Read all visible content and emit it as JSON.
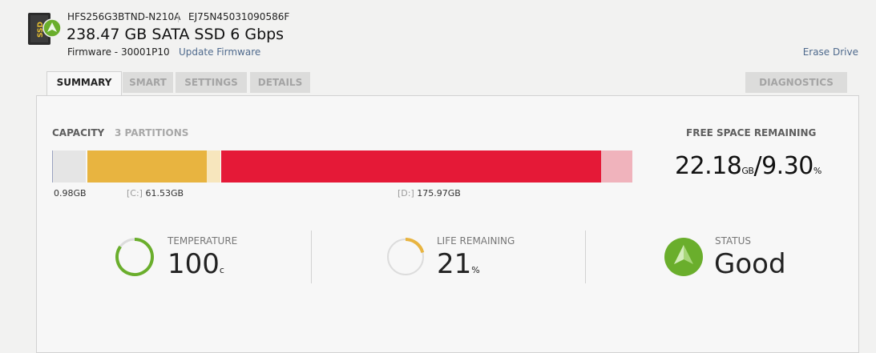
{
  "drive": {
    "model": "HFS256G3BTND-N210A",
    "serial": "EJ75N45031090586F",
    "title": "238.47 GB SATA SSD 6 Gbps",
    "firmware": "Firmware - 30001P10",
    "icon_text": "SSD"
  },
  "links": {
    "update_firmware": "Update Firmware",
    "erase_drive": "Erase Drive"
  },
  "tabs": [
    "SUMMARY",
    "SMART",
    "SETTINGS",
    "DETAILS",
    "DIAGNOSTICS"
  ],
  "active_tab": "SUMMARY",
  "capacity": {
    "label": "CAPACITY",
    "partitions": "3 PARTITIONS",
    "segments": [
      {
        "prefix": "",
        "size": "0.98GB",
        "used_color": "#e5e5e5",
        "free_color": "#e5e5e5"
      },
      {
        "prefix": "[C:]",
        "size": "61.53GB",
        "used_color": "#e8b440",
        "free_color": "#f7e6bd"
      },
      {
        "prefix": "[D:]",
        "size": "175.97GB",
        "used_color": "#e51937",
        "free_color": "#f0b3bc"
      }
    ]
  },
  "free_space": {
    "label": "FREE SPACE REMAINING",
    "gb_value": "22.18",
    "gb_unit": "GB",
    "separator": "/",
    "pct_value": "9.30",
    "pct_unit": "%"
  },
  "temperature": {
    "label": "TEMPERATURE",
    "value": "100",
    "unit": "c",
    "gauge_fraction": 0.85,
    "color": "#6aae2c"
  },
  "life": {
    "label": "LIFE REMAINING",
    "value": "21",
    "unit": "%",
    "gauge_fraction": 0.21,
    "color": "#e8b440"
  },
  "status": {
    "label": "STATUS",
    "value": "Good",
    "color": "#6aae2c"
  },
  "colors": {
    "accent_green": "#6aae2c",
    "link": "#4f6a8d"
  }
}
